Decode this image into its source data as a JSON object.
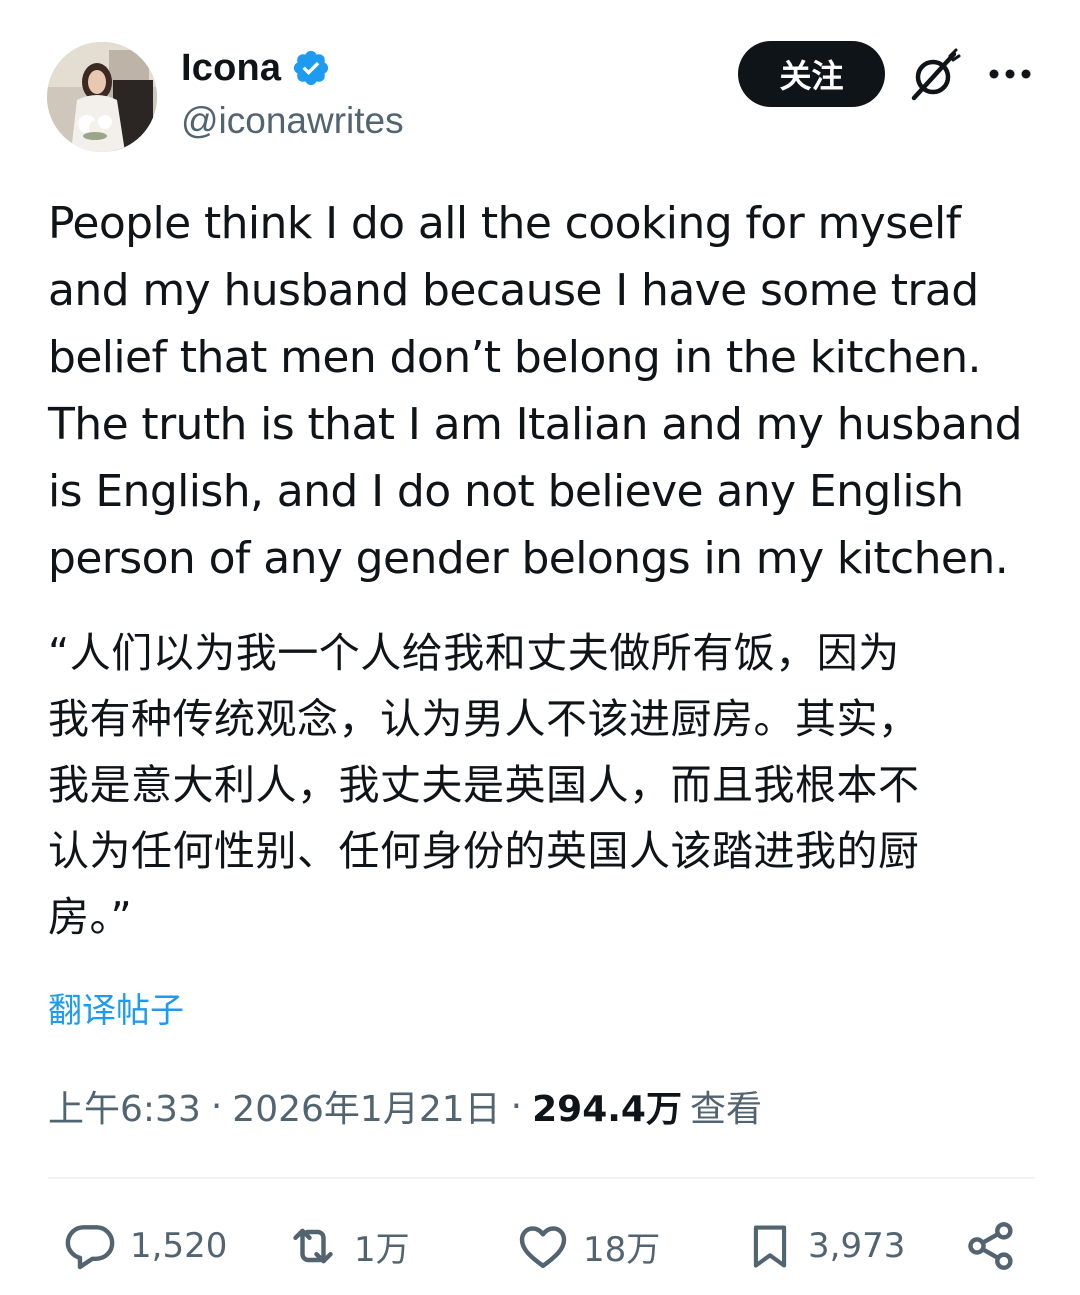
{
  "author": {
    "display_name": "Icona",
    "handle": "@iconawrites",
    "verified_color": "#1d9bf0"
  },
  "header": {
    "follow_label": "关注"
  },
  "tweet": {
    "text": "People think I do all the cooking for myself\nand my husband because I have some trad\nbelief that men don’t belong in the kitchen.\nThe truth is that I am Italian and my husband\nis English, and I do not believe any English\nperson of any gender belongs in my kitchen.",
    "translation": "“人们以为我一个人给我和丈夫做所有饭，因为\n我有种传统观念，认为男人不该进厨房。其实，\n我是意大利人，我丈夫是英国人，而且我根本不\n认为任何性别、任何身份的英国人该踏进我的厨\n房。”",
    "translate_label": "翻译帖子"
  },
  "meta": {
    "time": "上午6:33",
    "separator": "·",
    "date": "2026年1月21日",
    "views_count": "294.4万",
    "views_label": "查看"
  },
  "actions": {
    "replies": "1,520",
    "reposts": "1万",
    "likes": "18万",
    "bookmarks": "3,973"
  },
  "colors": {
    "text": "#0f1419",
    "secondary": "#536471",
    "accent": "#1d9bf0",
    "divider": "#eff3f4"
  },
  "icons": [
    "verified-badge-icon",
    "grok-icon",
    "more-icon",
    "reply-icon",
    "repost-icon",
    "like-icon",
    "bookmark-icon",
    "share-icon"
  ]
}
